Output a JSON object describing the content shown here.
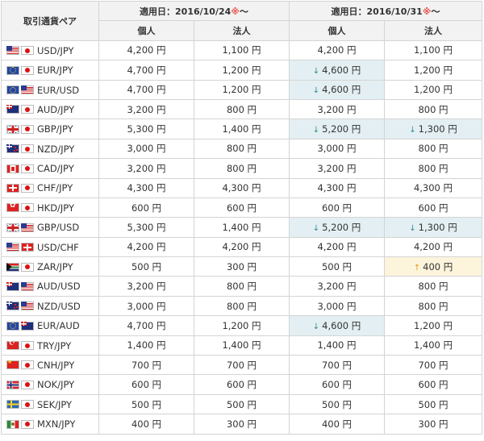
{
  "header": {
    "pair_label": "取引通貨ペア",
    "period1_label": "適用日：2016/10/24",
    "period2_label": "適用日：2016/10/31",
    "note_mark": "※",
    "tilde": "～",
    "individual_label": "個人",
    "corporate_label": "法人"
  },
  "colors": {
    "decrease_bg": "#e3eff3",
    "increase_bg": "#fdf4dc",
    "decrease_arrow": "#2f8c8c",
    "increase_arrow": "#e39b1c",
    "note_mark": "#e8504a"
  },
  "rows": [
    {
      "pair": "USD/JPY",
      "flag1": "USD",
      "flag2": "JPY",
      "p1i": "4,200 円",
      "p1c": "1,100 円",
      "p2i": "4,200 円",
      "p2c": "1,100 円",
      "p2i_change": "",
      "p2c_change": ""
    },
    {
      "pair": "EUR/JPY",
      "flag1": "EUR",
      "flag2": "JPY",
      "p1i": "4,700 円",
      "p1c": "1,200 円",
      "p2i": "4,600 円",
      "p2c": "1,200 円",
      "p2i_change": "down",
      "p2c_change": ""
    },
    {
      "pair": "EUR/USD",
      "flag1": "EUR",
      "flag2": "USD",
      "p1i": "4,700 円",
      "p1c": "1,200 円",
      "p2i": "4,600 円",
      "p2c": "1,200 円",
      "p2i_change": "down",
      "p2c_change": ""
    },
    {
      "pair": "AUD/JPY",
      "flag1": "AUD",
      "flag2": "JPY",
      "p1i": "3,200 円",
      "p1c": "800 円",
      "p2i": "3,200 円",
      "p2c": "800 円",
      "p2i_change": "",
      "p2c_change": ""
    },
    {
      "pair": "GBP/JPY",
      "flag1": "GBP",
      "flag2": "JPY",
      "p1i": "5,300 円",
      "p1c": "1,400 円",
      "p2i": "5,200 円",
      "p2c": "1,300 円",
      "p2i_change": "down",
      "p2c_change": "down"
    },
    {
      "pair": "NZD/JPY",
      "flag1": "NZD",
      "flag2": "JPY",
      "p1i": "3,000 円",
      "p1c": "800 円",
      "p2i": "3,000 円",
      "p2c": "800 円",
      "p2i_change": "",
      "p2c_change": ""
    },
    {
      "pair": "CAD/JPY",
      "flag1": "CAD",
      "flag2": "JPY",
      "p1i": "3,200 円",
      "p1c": "800 円",
      "p2i": "3,200 円",
      "p2c": "800 円",
      "p2i_change": "",
      "p2c_change": ""
    },
    {
      "pair": "CHF/JPY",
      "flag1": "CHF",
      "flag2": "JPY",
      "p1i": "4,300 円",
      "p1c": "4,300 円",
      "p2i": "4,300 円",
      "p2c": "4,300 円",
      "p2i_change": "",
      "p2c_change": ""
    },
    {
      "pair": "HKD/JPY",
      "flag1": "HKD",
      "flag2": "JPY",
      "p1i": "600 円",
      "p1c": "600 円",
      "p2i": "600 円",
      "p2c": "600 円",
      "p2i_change": "",
      "p2c_change": ""
    },
    {
      "pair": "GBP/USD",
      "flag1": "GBP",
      "flag2": "USD",
      "p1i": "5,300 円",
      "p1c": "1,400 円",
      "p2i": "5,200 円",
      "p2c": "1,300 円",
      "p2i_change": "down",
      "p2c_change": "down"
    },
    {
      "pair": "USD/CHF",
      "flag1": "USD",
      "flag2": "CHF",
      "p1i": "4,200 円",
      "p1c": "4,200 円",
      "p2i": "4,200 円",
      "p2c": "4,200 円",
      "p2i_change": "",
      "p2c_change": ""
    },
    {
      "pair": "ZAR/JPY",
      "flag1": "ZAR",
      "flag2": "JPY",
      "p1i": "500 円",
      "p1c": "300 円",
      "p2i": "500 円",
      "p2c": "400 円",
      "p2i_change": "",
      "p2c_change": "up"
    },
    {
      "pair": "AUD/USD",
      "flag1": "AUD",
      "flag2": "USD",
      "p1i": "3,200 円",
      "p1c": "800 円",
      "p2i": "3,200 円",
      "p2c": "800 円",
      "p2i_change": "",
      "p2c_change": ""
    },
    {
      "pair": "NZD/USD",
      "flag1": "NZD",
      "flag2": "USD",
      "p1i": "3,000 円",
      "p1c": "800 円",
      "p2i": "3,000 円",
      "p2c": "800 円",
      "p2i_change": "",
      "p2c_change": ""
    },
    {
      "pair": "EUR/AUD",
      "flag1": "EUR",
      "flag2": "AUD",
      "p1i": "4,700 円",
      "p1c": "1,200 円",
      "p2i": "4,600 円",
      "p2c": "1,200 円",
      "p2i_change": "down",
      "p2c_change": ""
    },
    {
      "pair": "TRY/JPY",
      "flag1": "TRY",
      "flag2": "JPY",
      "p1i": "1,400 円",
      "p1c": "1,400 円",
      "p2i": "1,400 円",
      "p2c": "1,400 円",
      "p2i_change": "",
      "p2c_change": ""
    },
    {
      "pair": "CNH/JPY",
      "flag1": "CNH",
      "flag2": "JPY",
      "p1i": "700 円",
      "p1c": "700 円",
      "p2i": "700 円",
      "p2c": "700 円",
      "p2i_change": "",
      "p2c_change": ""
    },
    {
      "pair": "NOK/JPY",
      "flag1": "NOK",
      "flag2": "JPY",
      "p1i": "600 円",
      "p1c": "600 円",
      "p2i": "600 円",
      "p2c": "600 円",
      "p2i_change": "",
      "p2c_change": ""
    },
    {
      "pair": "SEK/JPY",
      "flag1": "SEK",
      "flag2": "JPY",
      "p1i": "500 円",
      "p1c": "500 円",
      "p2i": "500 円",
      "p2c": "500 円",
      "p2i_change": "",
      "p2c_change": ""
    },
    {
      "pair": "MXN/JPY",
      "flag1": "MXN",
      "flag2": "JPY",
      "p1i": "400 円",
      "p1c": "300 円",
      "p2i": "400 円",
      "p2c": "300 円",
      "p2i_change": "",
      "p2c_change": ""
    }
  ]
}
